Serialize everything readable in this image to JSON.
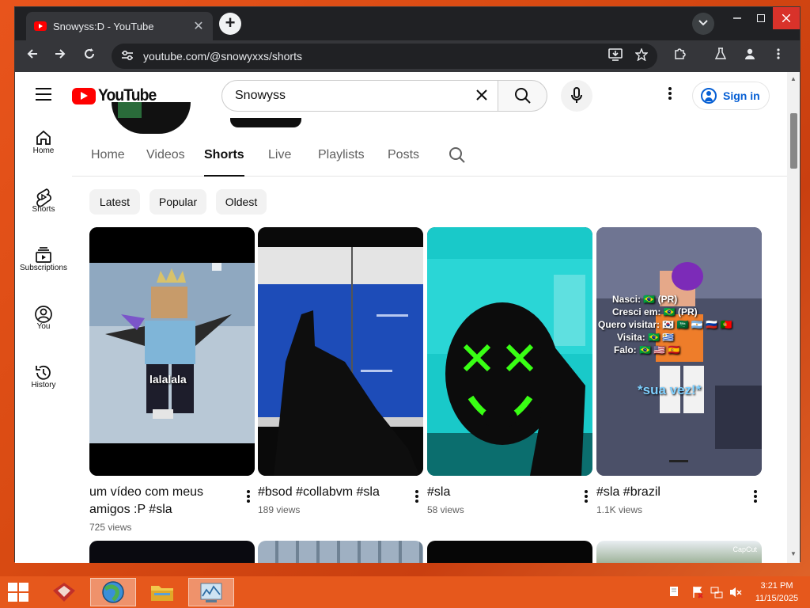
{
  "browser": {
    "tab_title": "Snowyss:D - YouTube",
    "url": "youtube.com/@snowyxxs/shorts",
    "new_tab_symbol": "+",
    "close_symbol": "✕"
  },
  "youtube": {
    "logo_text": "YouTube",
    "search_value": "Snowyss",
    "sign_in_label": "Sign in",
    "sidebar": [
      {
        "label": "Home",
        "icon": "home-icon"
      },
      {
        "label": "Shorts",
        "icon": "shorts-icon"
      },
      {
        "label": "Subscriptions",
        "icon": "subscriptions-icon"
      },
      {
        "label": "You",
        "icon": "you-icon"
      },
      {
        "label": "History",
        "icon": "history-icon"
      }
    ],
    "channel_tabs": [
      "Home",
      "Videos",
      "Shorts",
      "Live",
      "Playlists",
      "Posts"
    ],
    "active_tab": "Shorts",
    "chips": [
      "Latest",
      "Popular",
      "Oldest"
    ],
    "shorts": [
      {
        "title": "um vídeo com meus amigos :P #sla",
        "views": "725 views",
        "overlay": "lalalala"
      },
      {
        "title": "#bsod #collabvm #sla",
        "views": "189 views",
        "overlay": ""
      },
      {
        "title": "#sla",
        "views": "58 views",
        "overlay": ""
      },
      {
        "title": "#sla #brazil",
        "views": "1.1K views",
        "overlay_lines": [
          "Nasci: 🇧🇷 (PR)",
          "Cresci em: 🇧🇷 (PR)",
          "Quero visitar: 🇰🇷 🇸🇦 🇦🇷 🇷🇺 🇵🇹",
          "Visita: 🇧🇷 🇺🇾",
          "Falo: 🇧🇷 🇺🇸 🇪🇸"
        ],
        "overlay_bottom": "*sua vez!*"
      }
    ],
    "row2_overlay": "CapCut"
  },
  "taskbar": {
    "time": "3:21 PM",
    "date": "11/15/2025"
  },
  "colors": {
    "youtube_red": "#ff0000",
    "link_blue": "#065fd4",
    "desktop_orange": "#e6581c"
  }
}
